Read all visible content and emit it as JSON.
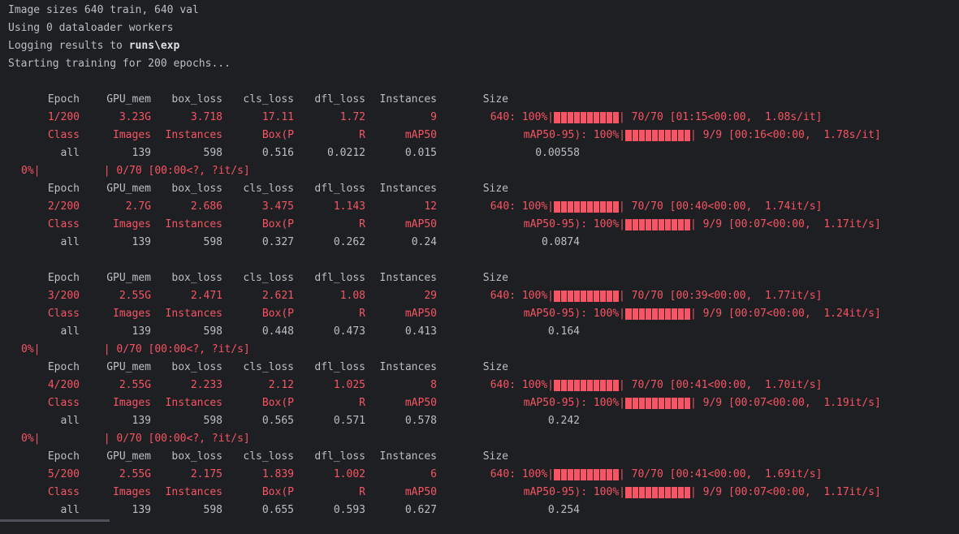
{
  "info": [
    [
      "Image sizes 640 train, 640 val"
    ],
    [
      "Using 0 dataloader workers"
    ],
    [
      "Logging results to ",
      "runs\\exp"
    ],
    [
      "Starting training for 200 epochs..."
    ]
  ],
  "train_header": [
    "Epoch",
    "GPU_mem",
    "box_loss",
    "cls_loss",
    "dfl_loss",
    "Instances",
    "Size"
  ],
  "val_header": [
    "Class",
    "Images",
    "Instances",
    "Box(P",
    "R",
    "mAP50",
    "mAP50-95): 100%|"
  ],
  "empty_progress": "0%|          | 0/70 [00:00<?, ?it/s]",
  "epochs": [
    {
      "train": [
        "1/200",
        "3.23G",
        "3.718",
        "17.11",
        "1.72",
        "9",
        "640: 100%|"
      ],
      "train_tail": "| 70/70 [01:15<00:00,  1.08s/it]",
      "val_tail": "| 9/9 [00:16<00:00,  1.78s/it]",
      "metrics": [
        "all",
        "139",
        "598",
        "0.516",
        "0.0212",
        "0.015",
        "0.00558"
      ],
      "progress_after": true
    },
    {
      "train": [
        "2/200",
        "2.7G",
        "2.686",
        "3.475",
        "1.143",
        "12",
        "640: 100%|"
      ],
      "train_tail": "| 70/70 [00:40<00:00,  1.74it/s]",
      "val_tail": "| 9/9 [00:07<00:00,  1.17it/s]",
      "metrics": [
        "all",
        "139",
        "598",
        "0.327",
        "0.262",
        "0.24",
        "0.0874"
      ],
      "progress_after": false
    },
    {
      "train": [
        "3/200",
        "2.55G",
        "2.471",
        "2.621",
        "1.08",
        "29",
        "640: 100%|"
      ],
      "train_tail": "| 70/70 [00:39<00:00,  1.77it/s]",
      "val_tail": "| 9/9 [00:07<00:00,  1.24it/s]",
      "metrics": [
        "all",
        "139",
        "598",
        "0.448",
        "0.473",
        "0.413",
        "0.164"
      ],
      "progress_after": true
    },
    {
      "train": [
        "4/200",
        "2.55G",
        "2.233",
        "2.12",
        "1.025",
        "8",
        "640: 100%|"
      ],
      "train_tail": "| 70/70 [00:41<00:00,  1.70it/s]",
      "val_tail": "| 9/9 [00:07<00:00,  1.19it/s]",
      "metrics": [
        "all",
        "139",
        "598",
        "0.565",
        "0.571",
        "0.578",
        "0.242"
      ],
      "progress_after": true
    },
    {
      "train": [
        "5/200",
        "2.55G",
        "2.175",
        "1.839",
        "1.002",
        "6",
        "640: 100%|"
      ],
      "train_tail": "| 70/70 [00:41<00:00,  1.69it/s]",
      "val_tail": "| 9/9 [00:07<00:00,  1.17it/s]",
      "metrics": [
        "all",
        "139",
        "598",
        "0.655",
        "0.593",
        "0.627",
        "0.254"
      ],
      "progress_after": false
    }
  ],
  "colors": {
    "background": "#1e1f22",
    "text": "#bcbec4",
    "progress": "#f75464"
  }
}
